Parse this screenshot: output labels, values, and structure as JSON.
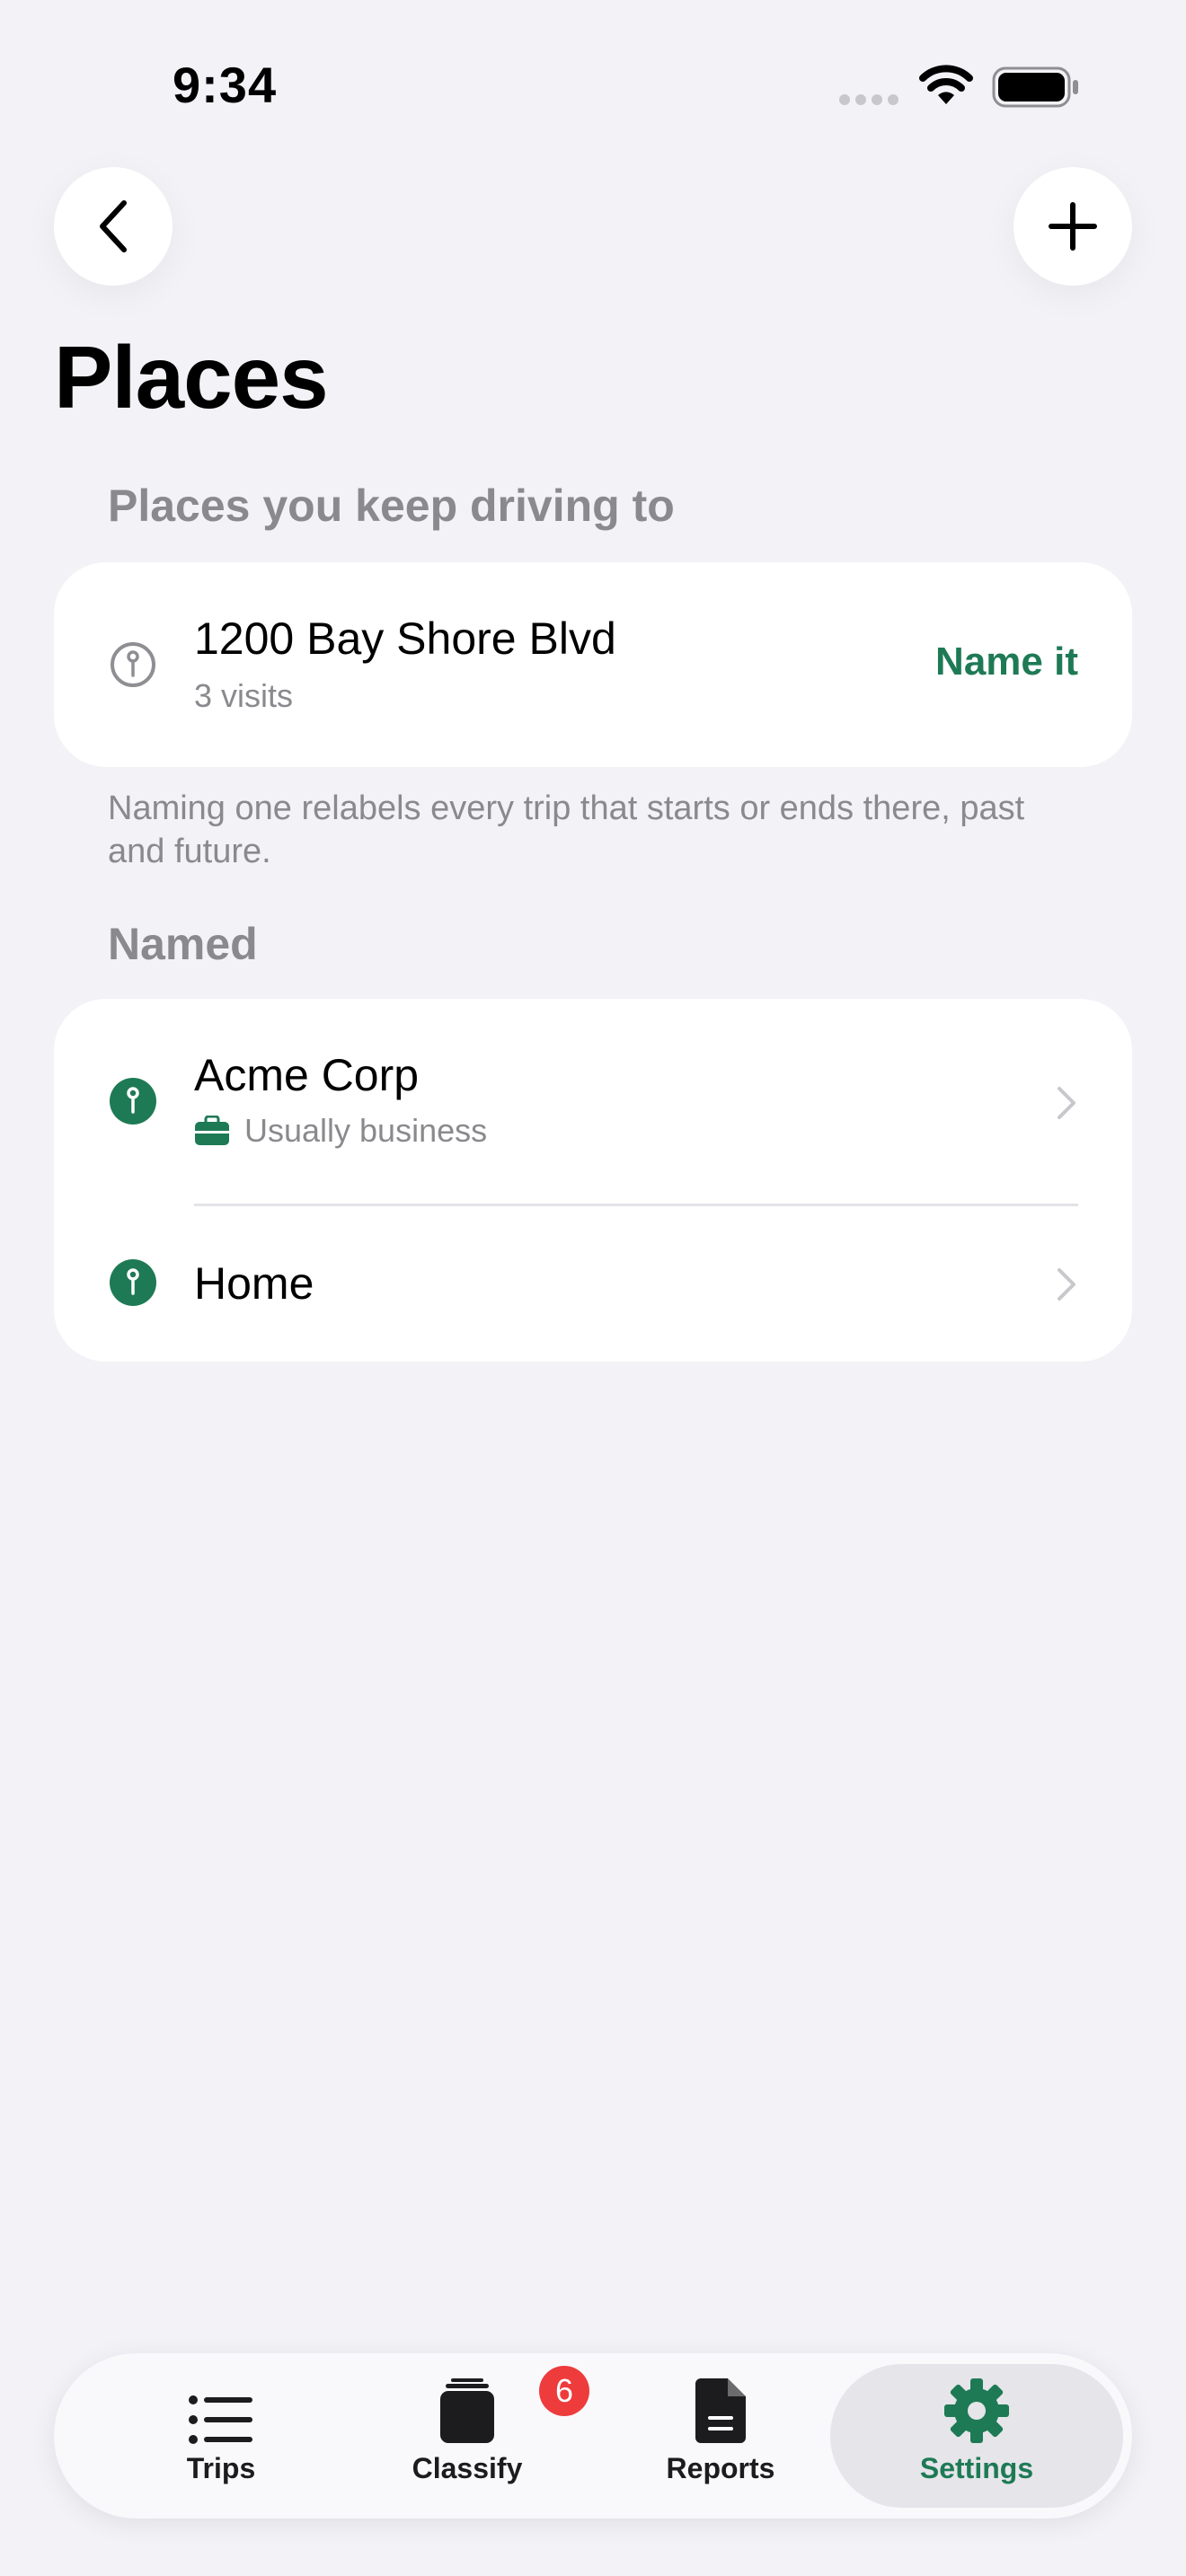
{
  "status_bar": {
    "time": "9:34"
  },
  "header": {
    "title": "Places"
  },
  "unnamed_section": {
    "header": "Places you keep driving to",
    "items": [
      {
        "title": "1200 Bay Shore Blvd",
        "subtitle": "3 visits",
        "action_label": "Name it",
        "icon": "pin-outline-icon"
      }
    ],
    "footnote": "Naming one relabels every trip that starts or ends there, past and future."
  },
  "named_section": {
    "header": "Named",
    "items": [
      {
        "title": "Acme Corp",
        "subtitle": "Usually business",
        "subtitle_icon": "briefcase-icon",
        "icon": "pin-filled-icon"
      },
      {
        "title": "Home",
        "icon": "pin-filled-icon"
      }
    ]
  },
  "tab_bar": {
    "tabs": [
      {
        "label": "Trips",
        "icon": "list-icon"
      },
      {
        "label": "Classify",
        "icon": "cards-stack-icon",
        "badge": "6"
      },
      {
        "label": "Reports",
        "icon": "document-icon"
      },
      {
        "label": "Settings",
        "icon": "gear-icon",
        "selected": true
      }
    ]
  },
  "colors": {
    "accent": "#1e7a55",
    "badge": "#ee3b3b",
    "background": "#f2f2f7"
  }
}
